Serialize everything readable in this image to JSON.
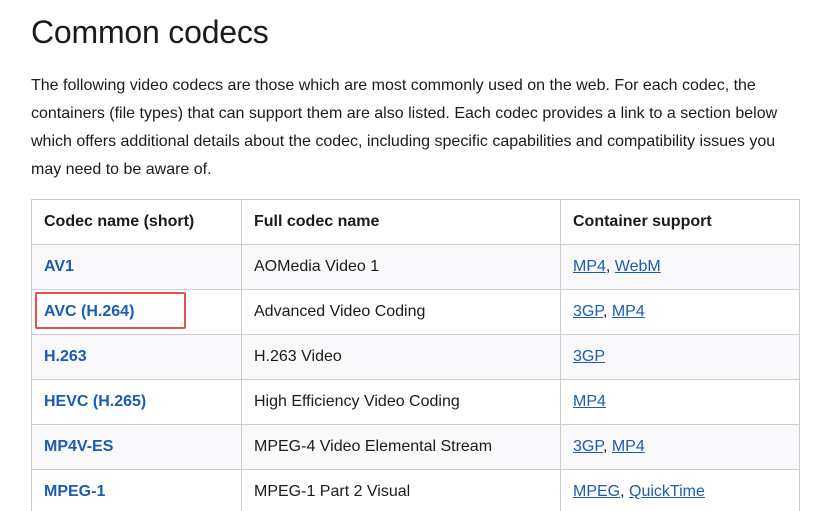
{
  "page": {
    "title": "Common codecs",
    "intro": "The following video codecs are those which are most commonly used on the web. For each codec, the containers (file types) that can support them are also listed. Each codec provides a link to a section below which offers additional details about the codec, including specific capabilities and compatibility issues you may need to be aware of."
  },
  "table": {
    "headers": [
      "Codec name (short)",
      "Full codec name",
      "Container support"
    ],
    "rows": [
      {
        "short": "AV1",
        "full": "AOMedia Video 1",
        "containers": [
          "MP4",
          "WebM"
        ]
      },
      {
        "short": "AVC (H.264)",
        "full": "Advanced Video Coding",
        "containers": [
          "3GP",
          "MP4"
        ]
      },
      {
        "short": "H.263",
        "full": "H.263 Video",
        "containers": [
          "3GP"
        ]
      },
      {
        "short": "HEVC (H.265)",
        "full": "High Efficiency Video Coding",
        "containers": [
          "MP4"
        ]
      },
      {
        "short": "MP4V-ES",
        "full": "MPEG-4 Video Elemental Stream",
        "containers": [
          "3GP",
          "MP4"
        ]
      },
      {
        "short": "MPEG-1",
        "full": "MPEG-1 Part 2 Visual",
        "containers": [
          "MPEG",
          "QuickTime"
        ]
      }
    ],
    "separator": ", "
  },
  "highlight": {
    "color": "#e8504f",
    "target_row": 1
  },
  "colors": {
    "link": "#1a5bb3",
    "text": "#1b1b1b",
    "border": "#cdcdcd",
    "stripe": "#f9f9fb"
  }
}
